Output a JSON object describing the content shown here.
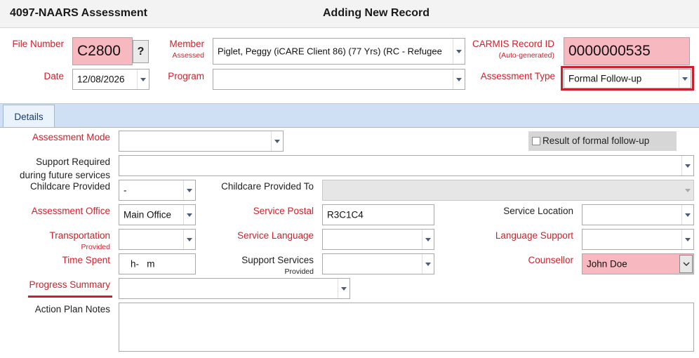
{
  "header": {
    "app_title": "4097-NAARS Assessment",
    "record_title": "Adding New Record"
  },
  "top": {
    "file_number_label": "File Number",
    "file_number_value": "C2800",
    "file_lookup_button": "?",
    "member_label": "Member",
    "member_sub": "Assessed",
    "member_value": "Piglet, Peggy (iCARE Client 86) (77 Yrs) (RC - Refugee",
    "carmis_label": "CARMIS Record ID",
    "carmis_sub": "(Auto-generated)",
    "carmis_value": "0000000535",
    "date_label": "Date",
    "date_value": "12/08/2026",
    "program_label": "Program",
    "program_value": "",
    "assessment_type_label": "Assessment Type",
    "assessment_type_value": "Formal Follow-up"
  },
  "tabs": {
    "details_label": "Details"
  },
  "details": {
    "assessment_mode_label": "Assessment Mode",
    "assessment_mode_value": "",
    "result_followup_label": "Result of formal follow-up",
    "support_required_label_1": "Support Required",
    "support_required_label_2": "during future services",
    "support_required_value": "",
    "childcare_provided_label": "Childcare Provided",
    "childcare_provided_value": "-",
    "childcare_to_label": "Childcare Provided To",
    "childcare_to_value": "",
    "assessment_office_label": "Assessment Office",
    "assessment_office_value": "Main Office",
    "service_postal_label": "Service Postal",
    "service_postal_value": "R3C1C4",
    "service_location_label": "Service Location",
    "service_location_value": "",
    "transportation_label": "Transportation",
    "transportation_sub": "Provided",
    "transportation_value": "",
    "service_language_label": "Service Language",
    "service_language_value": "",
    "language_support_label": "Language Support",
    "language_support_value": "",
    "time_spent_label": "Time Spent",
    "time_spent_value": "h-   m",
    "support_services_label": "Support Services",
    "support_services_sub": "Provided",
    "support_services_value": "",
    "counsellor_label": "Counsellor",
    "counsellor_value": "John Doe",
    "progress_summary_label": "Progress Summary",
    "progress_summary_value": "",
    "action_plan_label": "Action Plan Notes",
    "action_plan_value": ""
  },
  "colors": {
    "required_label": "#d0202a",
    "pink_field": "#f8b8c0",
    "highlight_border": "#cc1f2d",
    "tab_strip": "#cfe0f5"
  }
}
